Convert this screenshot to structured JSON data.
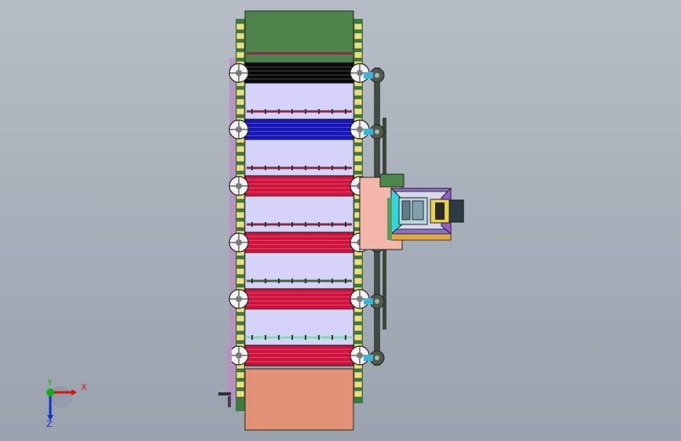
{
  "viewport": {
    "background_top": "#b6bdc6",
    "background_bottom": "#9aa2ad"
  },
  "model": {
    "conveyor_frame_color": "#4b8a4b",
    "top_panel_color": "#4f834c",
    "bottom_panel_color": "#e39275",
    "chain_color": "#2f3a2f",
    "rollers": [
      {
        "name": "roller-black",
        "color": "#080808"
      },
      {
        "name": "roller-blue",
        "color": "#1616b8"
      },
      {
        "name": "roller-red-1",
        "color": "#d0123e"
      },
      {
        "name": "roller-red-2",
        "color": "#d0123e"
      },
      {
        "name": "roller-red-3",
        "color": "#d0123e"
      },
      {
        "name": "roller-red-4",
        "color": "#d0123e"
      }
    ],
    "gap_panel_color": "#d4d4fa",
    "motor_housing_color": "#8c6fc9",
    "motor_accent_color": "#2fd8e0"
  },
  "triad": {
    "x_label": "X",
    "y_label": "Y",
    "z_label": "Z",
    "x_color": "#e01010",
    "y_color": "#10b010",
    "z_color": "#1030d0"
  }
}
